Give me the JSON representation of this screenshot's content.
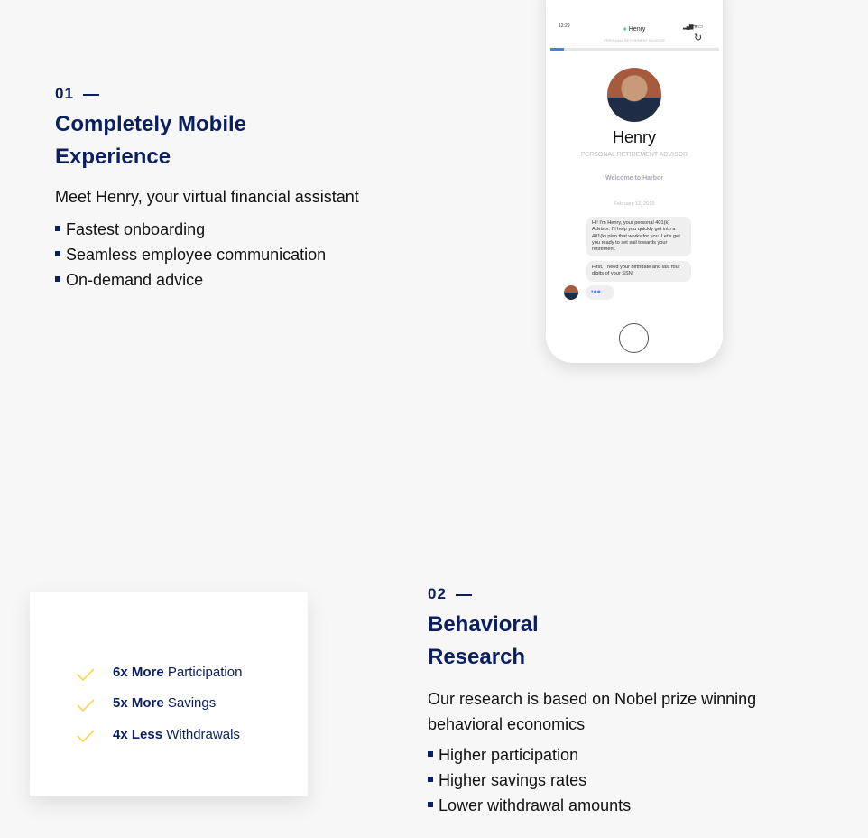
{
  "section1": {
    "number": "01",
    "title_lines": [
      "Completely Mobile",
      "Experience"
    ],
    "body": "Meet Henry, your virtual financial assistant",
    "bullets": [
      "Fastest onboarding",
      "Seamless employee communication",
      "On-demand advice"
    ]
  },
  "phone": {
    "time": "12:29",
    "header_name": "Henry",
    "header_subtitle": "PERSONAL RETIREMENT ADVISOR",
    "progress": 0.08,
    "profile_name": "Henry",
    "profile_subtitle": "PERSONAL RETIREMENT ADVISOR",
    "welcome": "Welcome to Harbor",
    "date": "February 12, 2019",
    "messages": [
      "Hi! I'm Henry, your personal 401(k) Advisor. I'll help you quickly get into a 401(k) plan that works for you. Let's get you ready to set sail towards your retirement.",
      "First, I need your birthdate and last four digits of your SSN."
    ],
    "accent": "#4a7cf7"
  },
  "card": {
    "items": [
      {
        "bold": "6x More",
        "rest": "Participation"
      },
      {
        "bold": "5x More",
        "rest": "Savings"
      },
      {
        "bold": "4x Less",
        "rest": "Withdrawals"
      }
    ],
    "check_color": "#f5d84a"
  },
  "section2": {
    "number": "02",
    "title_lines": [
      "Behavioral",
      "Research"
    ],
    "body": "Our research is based on Nobel prize winning behavioral economics",
    "bullets": [
      "Higher participation",
      "Higher savings rates",
      "Lower withdrawal amounts"
    ]
  },
  "colors": {
    "navy": "#0b1f5f",
    "background": "#f7f7f7"
  }
}
